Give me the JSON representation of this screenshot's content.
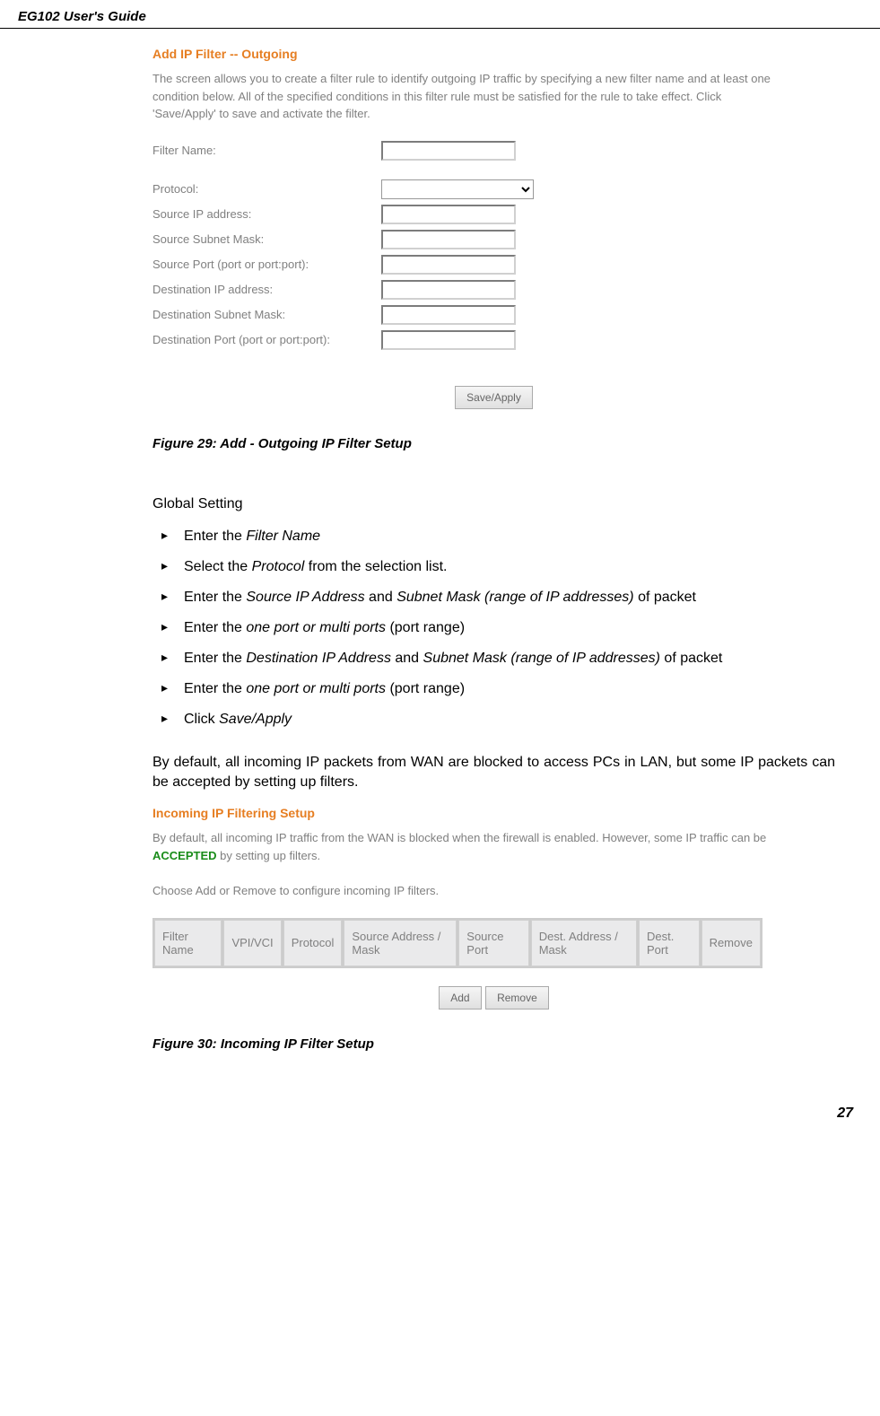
{
  "header": {
    "title": "EG102 User's Guide"
  },
  "screenshot1": {
    "title": "Add IP Filter -- Outgoing",
    "description": "The screen allows you to create a filter rule to identify outgoing IP traffic by specifying a new filter name and at least one condition below. All of the specified conditions in this filter rule must be satisfied for the rule to take effect. Click 'Save/Apply' to save and activate the filter.",
    "fields": {
      "filterName": "Filter Name:",
      "protocol": "Protocol:",
      "sourceIp": "Source IP address:",
      "sourceMask": "Source Subnet Mask:",
      "sourcePort": "Source Port (port or port:port):",
      "destIp": "Destination IP address:",
      "destMask": "Destination Subnet Mask:",
      "destPort": "Destination Port (port or port:port):"
    },
    "saveButton": "Save/Apply"
  },
  "figure1": {
    "caption": "Figure 29: Add - Outgoing IP Filter Setup"
  },
  "globalSetting": {
    "heading": "Global Setting",
    "items": [
      {
        "prefix": "Enter the ",
        "italic": "Filter Name",
        "suffix": ""
      },
      {
        "prefix": "Select the ",
        "italic": "Protocol",
        "suffix": " from the selection list."
      },
      {
        "prefix": "Enter the ",
        "italic": "Source IP Address",
        "middle": " and ",
        "italic2": "Subnet Mask (range of IP addresses)",
        "suffix": " of packet"
      },
      {
        "prefix": "Enter the ",
        "italic": "one port or multi ports",
        "suffix": " (port range)"
      },
      {
        "prefix": "Enter the ",
        "italic": "Destination IP Address",
        "middle": " and ",
        "italic2": "Subnet Mask (range of IP addresses)",
        "suffix": " of packet"
      },
      {
        "prefix": "Enter the ",
        "italic": "one port or multi ports",
        "suffix": " (port range)"
      },
      {
        "prefix": "Click ",
        "italic": "Save/Apply",
        "suffix": ""
      }
    ]
  },
  "paragraph": {
    "text": "By default, all incoming IP packets from WAN are blocked to access PCs in LAN, but some IP packets can be accepted by setting up filters."
  },
  "screenshot2": {
    "title": "Incoming IP Filtering Setup",
    "desc1": "By default, all incoming IP traffic from the WAN is blocked when the firewall is enabled. However, some IP traffic can be ",
    "accepted": "ACCEPTED",
    "desc1b": " by setting up filters.",
    "desc2": "Choose Add or Remove to configure incoming IP filters.",
    "columns": [
      "Filter Name",
      "VPI/VCI",
      "Protocol",
      "Source Address / Mask",
      "Source Port",
      "Dest. Address / Mask",
      "Dest. Port",
      "Remove"
    ],
    "addButton": "Add",
    "removeButton": "Remove"
  },
  "figure2": {
    "caption": "Figure 30: Incoming IP Filter Setup"
  },
  "footer": {
    "pageNumber": "27"
  }
}
